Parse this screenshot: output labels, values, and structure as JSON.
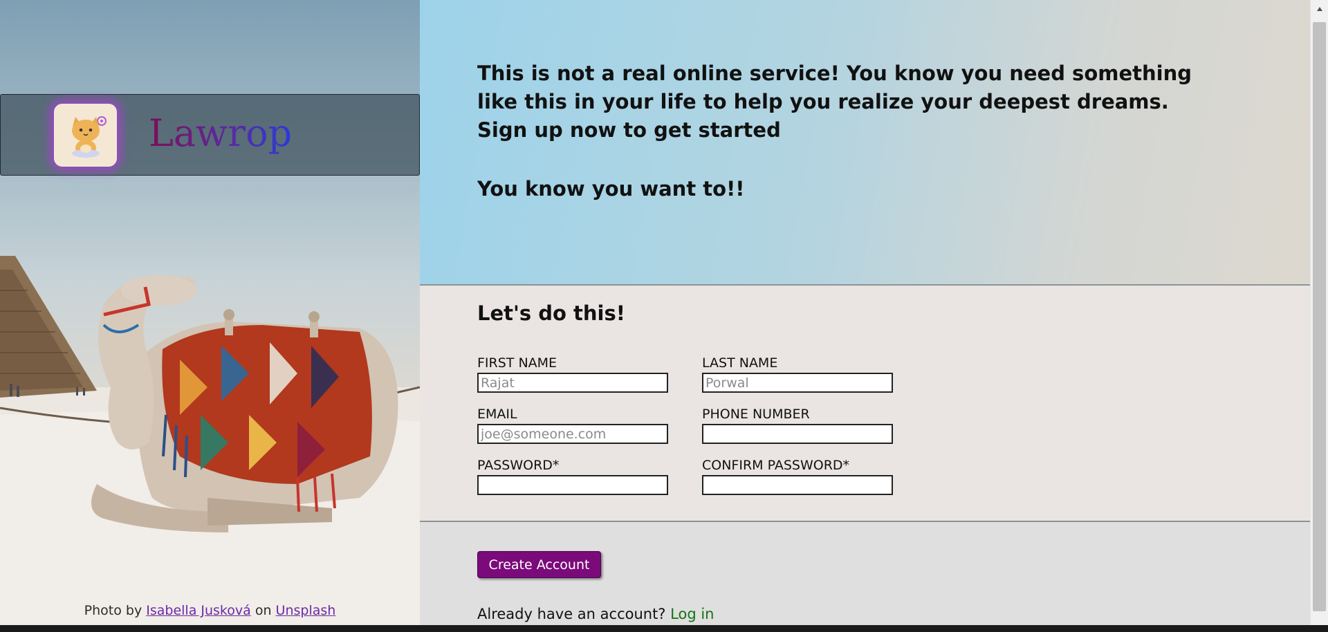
{
  "brand": {
    "name": "Lawrop",
    "logo_icon": "cat-mascot-icon"
  },
  "credit": {
    "prefix": "Photo by",
    "author": "Isabella Jusková",
    "middle": "on",
    "source": "Unsplash"
  },
  "intro": {
    "line1": "This is not a real online service! You know you need something like this in your life to help you realize your deepest dreams. Sign up now to get started",
    "line2": "You know you want to!!"
  },
  "form": {
    "title": "Let's do this!",
    "first_name": {
      "label": "FIRST NAME",
      "placeholder": "Rajat",
      "value": ""
    },
    "last_name": {
      "label": "LAST NAME",
      "placeholder": "Porwal",
      "value": ""
    },
    "email": {
      "label": "EMAIL",
      "placeholder": "joe@someone.com",
      "value": ""
    },
    "phone": {
      "label": "PHONE NUMBER",
      "placeholder": "",
      "value": ""
    },
    "password": {
      "label": "PASSWORD*",
      "placeholder": "",
      "value": ""
    },
    "confirm_password": {
      "label": "CONFIRM PASSWORD*",
      "placeholder": "",
      "value": ""
    }
  },
  "actions": {
    "create_label": "Create Account",
    "login_prompt": "Already have an account?",
    "login_link": "Log in"
  },
  "colors": {
    "accent": "#7b0a7b",
    "login_link": "#137313",
    "glow": "#b03cdc"
  }
}
